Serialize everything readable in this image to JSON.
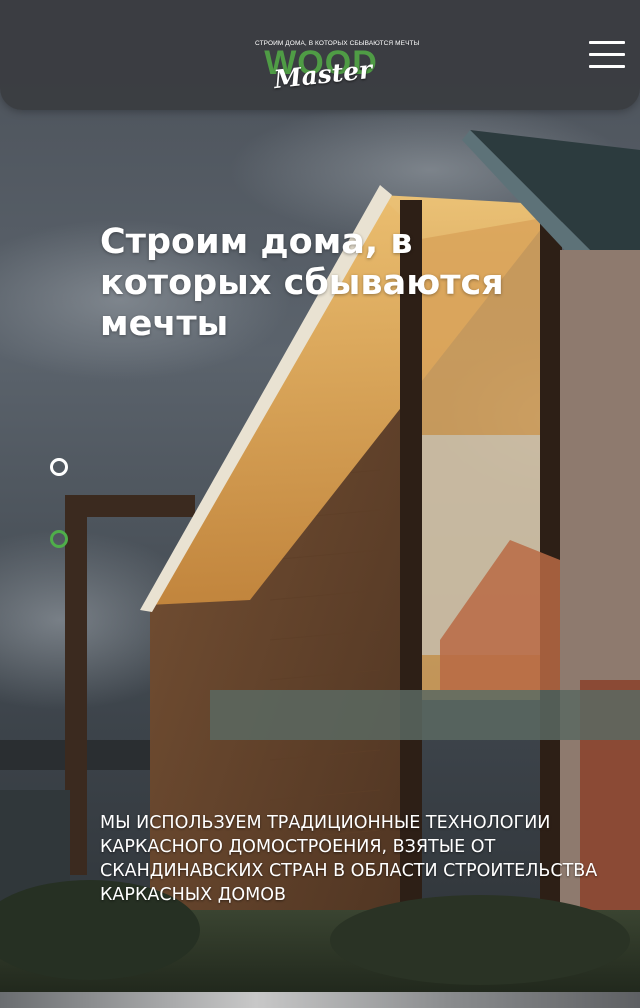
{
  "header": {
    "logo": {
      "tagline": "СТРОИМ ДОМА, В КОТОРЫХ СБЫВАЮТСЯ МЕЧТЫ",
      "word": "WOOD",
      "script": "Master"
    },
    "menu_icon": "hamburger-menu-icon"
  },
  "hero": {
    "title": "Строим дома, в которых сбываются мечты",
    "subtitle": "Мы используем традиционные технологии каркасного домостроения, взятые от скандинавских стран в области строительства каркасных домов"
  },
  "slider": {
    "dots": [
      "inactive",
      "active"
    ]
  },
  "colors": {
    "accent_green": "#4fae4a",
    "header_bg": "#3a3c40",
    "text": "#ffffff"
  }
}
